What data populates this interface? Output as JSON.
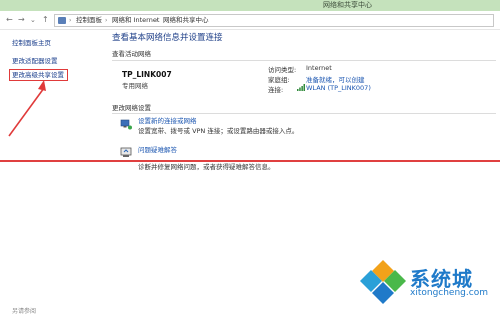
{
  "window": {
    "title": "网络和共享中心"
  },
  "address_bar": {
    "back": "←",
    "forward": "→",
    "dropdown": "⌄",
    "up": "↑",
    "crumbs": [
      "控制面板",
      "网络和 Internet",
      "网络和共享中心"
    ],
    "separators": [
      "›",
      "›",
      "›"
    ]
  },
  "left_pane": {
    "items": [
      {
        "label": "控制面板主页"
      },
      {
        "label": "更改适配器设置"
      },
      {
        "label": "更改高级共享设置"
      }
    ],
    "bottom_text": "另请参阅"
  },
  "main": {
    "title": "查看基本网络信息并设置连接",
    "active_networks_header": "查看活动网络",
    "network": {
      "name": "TP_LINK007",
      "type": "专用网络",
      "access_type_label": "访问类型:",
      "access_type_value": "Internet",
      "homegroup_label": "家庭组:",
      "homegroup_value": "准备就绪，可以创建",
      "connections_label": "连接:",
      "connections_value": "WLAN (TP_LINK007)"
    },
    "change_settings_header": "更改网络设置",
    "tasks": [
      {
        "link": "设置新的连接或网络",
        "desc": "设置宽带、拨号或 VPN 连接；或设置路由器或接入点。"
      },
      {
        "link": "问题疑难解答",
        "desc": "诊断并修复网络问题，或者获得疑难解答信息。"
      }
    ]
  },
  "watermark": {
    "text": "系统城",
    "sub": "xitongcheng.com"
  },
  "colors": {
    "accent_red": "#e03a3a",
    "link_blue": "#1a55b0",
    "titlebar_green": "#c5e2bc"
  }
}
